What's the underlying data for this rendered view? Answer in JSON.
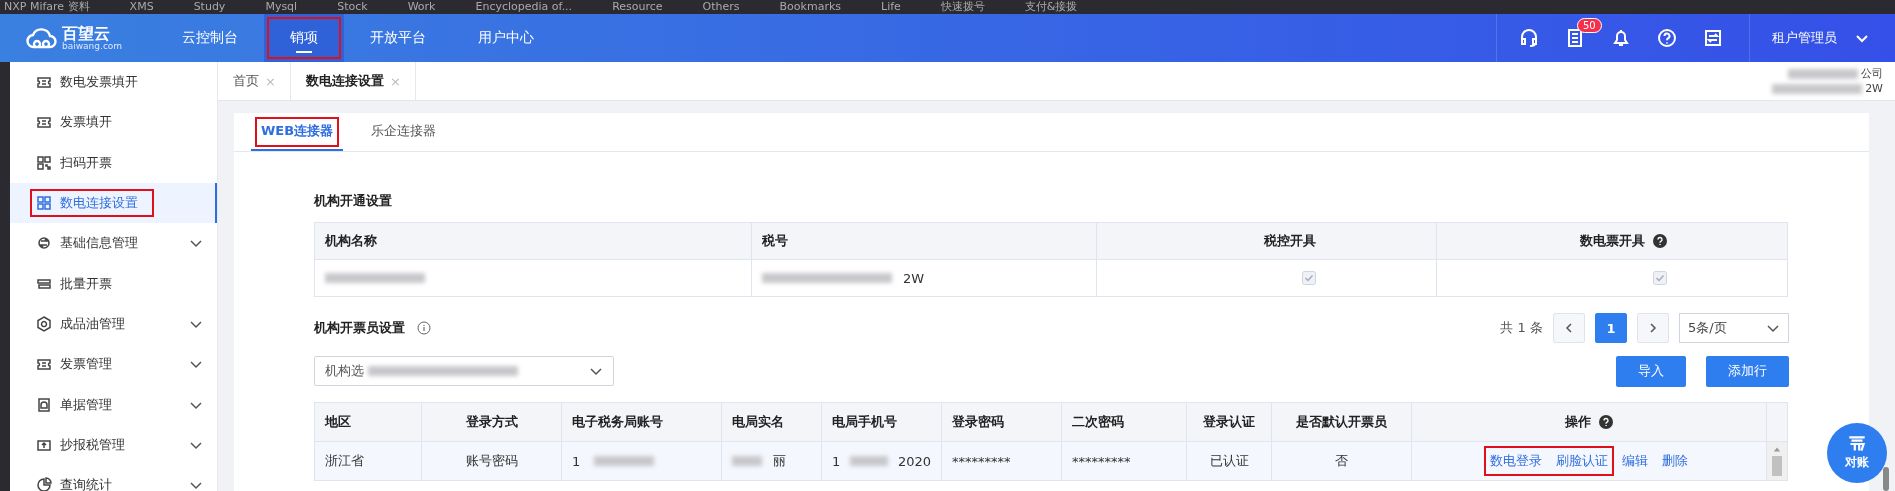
{
  "bookmarks": [
    "NXP Mifare 资料",
    "XMS",
    "Study",
    "Mysql",
    "Stock",
    "Work",
    "Encyclopedia of...",
    "Resource",
    "Others",
    "Bookmarks",
    "Life",
    "快速拨号",
    "支付&接拨"
  ],
  "brand": {
    "name": "百望云",
    "tagline": "baiwang.com"
  },
  "nav": [
    {
      "label": "云控制台",
      "selected": false,
      "annotated": false
    },
    {
      "label": "销项",
      "selected": true,
      "annotated": true
    },
    {
      "label": "开放平台",
      "selected": false,
      "annotated": false
    },
    {
      "label": "用户中心",
      "selected": false,
      "annotated": false
    }
  ],
  "header": {
    "badge": "50",
    "user": "租户管理员"
  },
  "sidebar": [
    {
      "label": "数电发票填开",
      "kind": "ticket",
      "expandable": false,
      "selected": false,
      "annotated": false
    },
    {
      "label": "发票填开",
      "kind": "ticket",
      "expandable": false,
      "selected": false,
      "annotated": false
    },
    {
      "label": "扫码开票",
      "kind": "qr",
      "expandable": false,
      "selected": false,
      "annotated": false
    },
    {
      "label": "数电连接设置",
      "kind": "grid",
      "expandable": false,
      "selected": true,
      "annotated": true
    },
    {
      "label": "基础信息管理",
      "kind": "swap",
      "expandable": true,
      "selected": false,
      "annotated": false
    },
    {
      "label": "批量开票",
      "kind": "stack",
      "expandable": false,
      "selected": false,
      "annotated": false
    },
    {
      "label": "成品油管理",
      "kind": "gear",
      "expandable": true,
      "selected": false,
      "annotated": false
    },
    {
      "label": "发票管理",
      "kind": "ticket",
      "expandable": true,
      "selected": false,
      "annotated": false
    },
    {
      "label": "单据管理",
      "kind": "doc",
      "expandable": true,
      "selected": false,
      "annotated": false
    },
    {
      "label": "抄报税管理",
      "kind": "upload",
      "expandable": true,
      "selected": false,
      "annotated": false
    },
    {
      "label": "查询统计",
      "kind": "pie",
      "expandable": true,
      "selected": false,
      "annotated": false
    }
  ],
  "page_tabs": [
    {
      "label": "首页",
      "close": "×",
      "selected": false
    },
    {
      "label": "数电连接设置",
      "close": "×",
      "selected": true
    }
  ],
  "company": {
    "line1": "公司",
    "line2": "2W"
  },
  "connector_tabs": [
    {
      "label": "WEB连接器",
      "selected": true,
      "annotated": true
    },
    {
      "label": "乐企连接器",
      "selected": false,
      "annotated": false
    }
  ],
  "org_section": {
    "title": "机构开通设置",
    "columns": [
      {
        "label": "机构名称",
        "help": false
      },
      {
        "label": "税号",
        "help": false
      },
      {
        "label": "税控开具",
        "help": false
      },
      {
        "label": "数电票开具",
        "help": true
      }
    ],
    "rows": [
      {
        "tax_tail": "2W",
        "tax_control": true,
        "digital": true
      }
    ]
  },
  "staff_section": {
    "title": "机构开票员设置",
    "total": "共 1 条",
    "pages": [
      {
        "label": "1",
        "selected": true
      }
    ],
    "page_size": "5条/页",
    "select_value": "机构选",
    "buttons": [
      "导入",
      "添加行"
    ],
    "columns": [
      {
        "label": "地区",
        "help": false
      },
      {
        "label": "登录方式",
        "help": false
      },
      {
        "label": "电子税务局账号",
        "help": false
      },
      {
        "label": "电局实名",
        "help": false
      },
      {
        "label": "电局手机号",
        "help": false
      },
      {
        "label": "登录密码",
        "help": false
      },
      {
        "label": "二次密码",
        "help": false
      },
      {
        "label": "登录认证",
        "help": false
      },
      {
        "label": "是否默认开票员",
        "help": false
      },
      {
        "label": "操作",
        "help": true
      }
    ],
    "rows": [
      {
        "region": "浙江省",
        "login_method": "账号密码",
        "account": "1",
        "real_name": "丽",
        "phone": "1",
        "phone_tail": "2020",
        "password": "*********",
        "second_password": "*********",
        "auth": "已认证",
        "default": "否",
        "actions": [
          {
            "label": "数电登录",
            "annotated": true
          },
          {
            "label": "刷脸认证",
            "annotated": true
          },
          {
            "label": "编辑",
            "annotated": false
          },
          {
            "label": "删除",
            "annotated": false
          }
        ]
      }
    ]
  },
  "float_button": {
    "label": "对账"
  }
}
